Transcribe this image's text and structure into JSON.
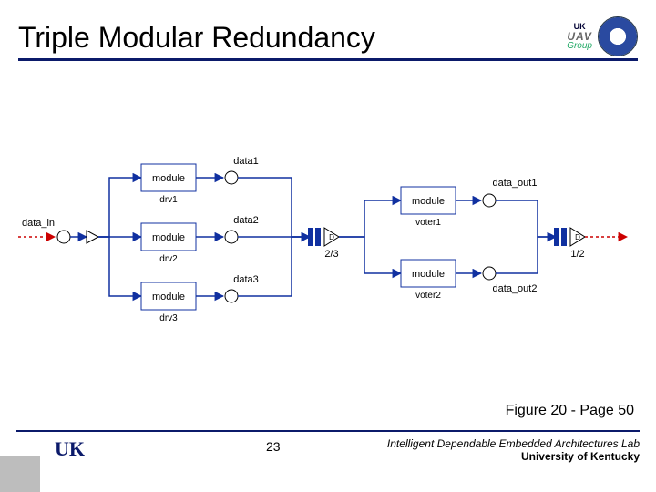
{
  "title": "Triple Modular Redundancy",
  "logo_uav": {
    "top": "UK",
    "mid": "UAV",
    "bot": "Group"
  },
  "caption": "Figure 20 - Page 50",
  "page_number": "23",
  "lab": "Intelligent Dependable Embedded Architectures Lab",
  "university": "University of Kentucky",
  "uk_logo_text": "UK",
  "diagram": {
    "input_label": "data_in",
    "left_modules": [
      {
        "box": "module",
        "below": "drv1",
        "out": "data1"
      },
      {
        "box": "module",
        "below": "drv2",
        "out": "data2"
      },
      {
        "box": "module",
        "below": "drv3",
        "out": "data3"
      }
    ],
    "gate1_label": "2/3",
    "right_modules": [
      {
        "box": "module",
        "below": "voter1",
        "out": "data_out1"
      },
      {
        "box": "module",
        "below": "voter2",
        "out": "data_out2"
      }
    ],
    "gate2_label": "1/2"
  },
  "chart_data": {
    "type": "diagram",
    "title": "Triple Modular Redundancy block diagram",
    "nodes": [
      {
        "id": "data_in",
        "kind": "input",
        "label": "data_in"
      },
      {
        "id": "drv1",
        "kind": "module",
        "label": "module",
        "sublabel": "drv1"
      },
      {
        "id": "drv2",
        "kind": "module",
        "label": "module",
        "sublabel": "drv2"
      },
      {
        "id": "drv3",
        "kind": "module",
        "label": "module",
        "sublabel": "drv3"
      },
      {
        "id": "data1",
        "kind": "signal",
        "label": "data1"
      },
      {
        "id": "data2",
        "kind": "signal",
        "label": "data2"
      },
      {
        "id": "data3",
        "kind": "signal",
        "label": "data3"
      },
      {
        "id": "vote23",
        "kind": "voter-gate",
        "label": "2/3"
      },
      {
        "id": "voter1",
        "kind": "module",
        "label": "module",
        "sublabel": "voter1"
      },
      {
        "id": "voter2",
        "kind": "module",
        "label": "module",
        "sublabel": "voter2"
      },
      {
        "id": "data_out1",
        "kind": "signal",
        "label": "data_out1"
      },
      {
        "id": "data_out2",
        "kind": "signal",
        "label": "data_out2"
      },
      {
        "id": "vote12",
        "kind": "voter-gate",
        "label": "1/2"
      },
      {
        "id": "output",
        "kind": "output",
        "label": ""
      }
    ],
    "edges": [
      [
        "data_in",
        "drv1"
      ],
      [
        "data_in",
        "drv2"
      ],
      [
        "data_in",
        "drv3"
      ],
      [
        "drv1",
        "data1"
      ],
      [
        "drv2",
        "data2"
      ],
      [
        "drv3",
        "data3"
      ],
      [
        "data1",
        "vote23"
      ],
      [
        "data2",
        "vote23"
      ],
      [
        "data3",
        "vote23"
      ],
      [
        "vote23",
        "voter1"
      ],
      [
        "vote23",
        "voter2"
      ],
      [
        "voter1",
        "data_out1"
      ],
      [
        "voter2",
        "data_out2"
      ],
      [
        "data_out1",
        "vote12"
      ],
      [
        "data_out2",
        "vote12"
      ],
      [
        "vote12",
        "output"
      ]
    ]
  }
}
